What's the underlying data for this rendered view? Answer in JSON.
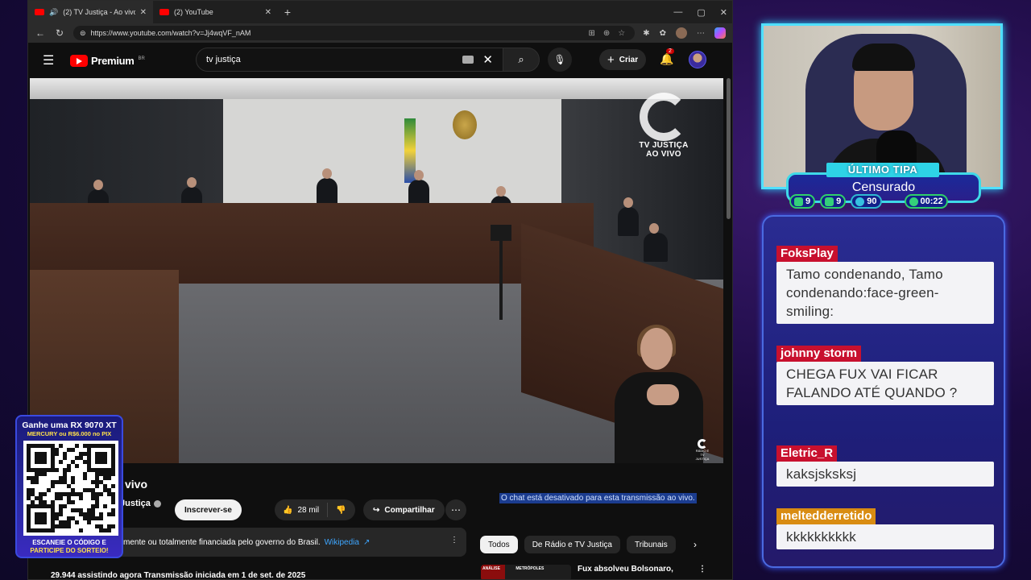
{
  "browser": {
    "tabs": [
      {
        "title": "(2) TV Justiça - Ao vivo - You",
        "active": true,
        "audio": true
      },
      {
        "title": "(2) YouTube",
        "active": false,
        "audio": false
      }
    ],
    "url": "https://www.youtube.com/watch?v=Jj4wqVF_nAM"
  },
  "youtube": {
    "logo_text": "Premium",
    "logo_region": "BR",
    "search_value": "tv justiça",
    "create_label": "Criar",
    "notification_count": "2",
    "video": {
      "overlay_brand_line1": "TV JUSTIÇA",
      "overlay_brand_line2": "AO VIVO",
      "mini_logo_text": "RÁDIO E TV JUSTIÇA"
    },
    "title_partial": "vivo",
    "channel_partial": "Justiça",
    "subscribe_label": "Inscrever-se",
    "likes": "28 mil",
    "share_label": "Compartilhar",
    "info_text": "mente ou totalmente financiada pelo governo do Brasil.",
    "info_link": "Wikipedia",
    "watch_stats": "29.944 assistindo agora  Transmissão iniciada em 1 de set. de 2025",
    "chat_disabled": "O chat está desativado para esta transmissão ao vivo.",
    "chips": [
      "Todos",
      "De Rádio e TV Justiça",
      "Tribunais"
    ],
    "related": {
      "thumb_label": "ANÁLISE",
      "thumb_brand": "METRÓPOLES",
      "title": "Fux absolveu Bolsonaro,"
    }
  },
  "overlay": {
    "ultimo_label": "ÚLTIMO TIPA",
    "ultimo_value": "Censurado",
    "stats": {
      "a": "9",
      "b": "9",
      "c": "90",
      "timer": "00:22"
    },
    "chat": [
      {
        "author": "FoksPlay",
        "text": "Tamo condenando, Tamo condenando:face-green-smiling:",
        "color": "#c8102e"
      },
      {
        "author": "johnny storm",
        "text": "CHEGA FUX VAI FICAR FALANDO ATÉ QUANDO ?",
        "color": "#c8102e"
      },
      {
        "author": "Eletric_R",
        "text": "kaksjsksksj",
        "color": "#c8102e"
      },
      {
        "author": "meltedderretido",
        "text": "kkkkkkkkkk",
        "color": "#d98c12"
      }
    ],
    "sponsor": {
      "headline": "Ganhe uma RX 9070 XT",
      "subline": "MERCURY ou R$6.000 no PIX",
      "footer1": "ESCANEIE O CÓDIGO E",
      "footer2": "PARTICIPE DO SORTEIO!"
    }
  }
}
